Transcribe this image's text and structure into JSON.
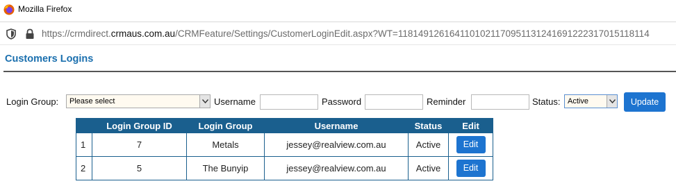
{
  "browser": {
    "window_title": "Mozilla Firefox",
    "url_prefix": "https://crmdirect.",
    "url_host": "crmaus.com.au",
    "url_path": "/CRMFeature/Settings/CustomerLoginEdit.aspx?WT=1181491261641101021170951131241691222317015118114"
  },
  "page": {
    "title": "Customers Logins"
  },
  "filters": {
    "login_group_label": "Login Group:",
    "login_group_value": "Please select",
    "username_label": "Username",
    "username_value": "",
    "password_label": "Password",
    "password_value": "",
    "reminder_label": "Reminder",
    "reminder_value": "",
    "status_label": "Status:",
    "status_value": "Active",
    "update_label": "Update"
  },
  "table": {
    "headers": [
      "",
      "Login Group ID",
      "Login Group",
      "Username",
      "Status",
      "Edit"
    ],
    "rows": [
      {
        "num": "1",
        "group_id": "7",
        "group": "Metals",
        "username": "jessey@realview.com.au",
        "status": "Active",
        "edit": "Edit"
      },
      {
        "num": "2",
        "group_id": "5",
        "group": "The Bunyip",
        "username": "jessey@realview.com.au",
        "status": "Active",
        "edit": "Edit"
      }
    ]
  },
  "colors": {
    "heading": "#1a6fae",
    "table_header": "#1a5f8e",
    "button": "#1d74d0"
  },
  "icons": [
    "firefox-logo-icon",
    "shield-icon",
    "lock-icon",
    "dropdown-arrow-icon"
  ]
}
